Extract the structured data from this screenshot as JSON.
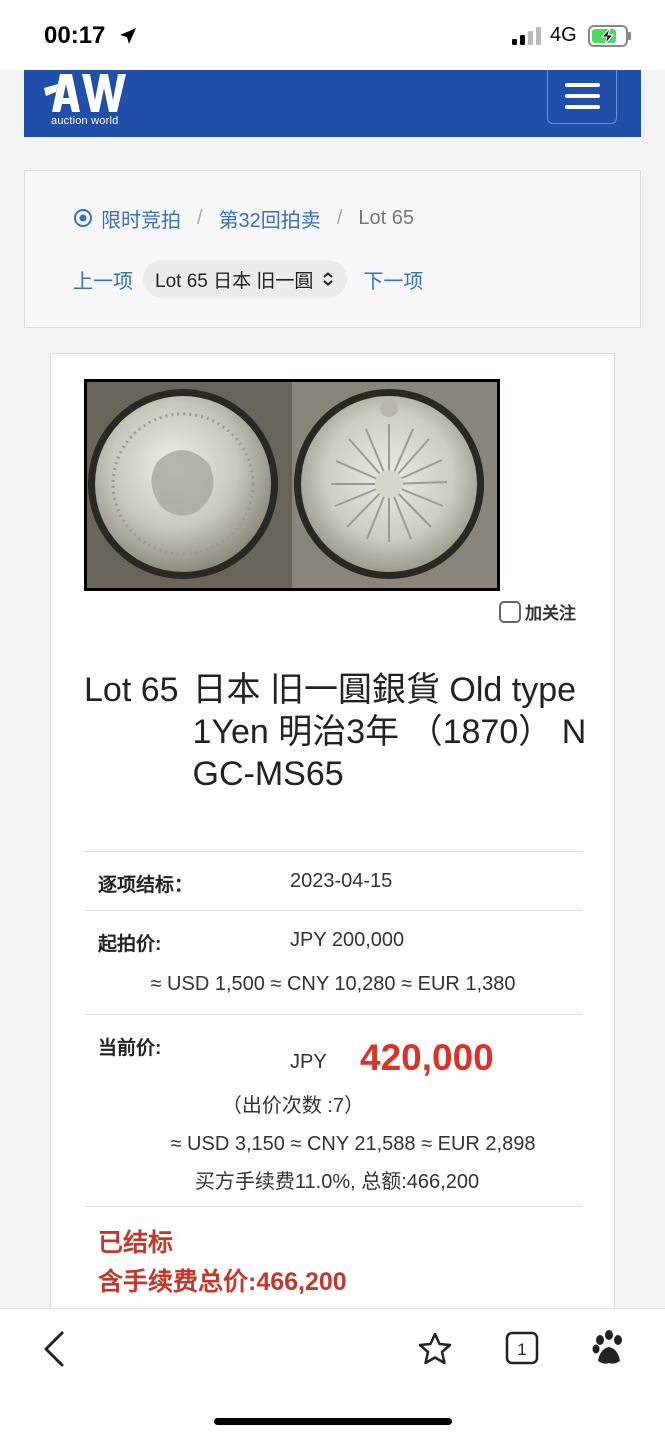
{
  "status_bar": {
    "time": "00:17",
    "network": "4G"
  },
  "navbar": {
    "logo_sub": "auction world",
    "accent_color": "#1f4fa8"
  },
  "breadcrumb": {
    "items": [
      "限时竞拍",
      "第32回拍卖",
      "Lot 65"
    ],
    "separator": "/"
  },
  "lot_nav": {
    "prev": "上一项",
    "select_value": "Lot 65 日本 旧一圓",
    "next": "下一项"
  },
  "follow": {
    "label": "加关注"
  },
  "lot": {
    "number": "Lot 65",
    "name": "日本 旧一圓銀貨 Old type 1Yen 明治3年 （1870） NGC-MS65"
  },
  "details": {
    "close_label": "逐项结标：",
    "close_date": "2023-04-15",
    "start_label": "起拍价:",
    "start_price": "JPY 200,000",
    "start_conversions": "≈ USD 1,500 ≈ CNY 10,280 ≈ EUR 1,380",
    "current_label": "当前价:",
    "current_currency": "JPY",
    "current_price": "420,000",
    "bid_count": "（出价次数 :7）",
    "current_conversions": "≈ USD 3,150 ≈ CNY 21,588 ≈ EUR 2,898",
    "fee_note": "买方手续费11.0%, 总额:466,200",
    "status": "已结标",
    "total_with_fee": "含手续费总价:466,200"
  },
  "colors": {
    "link": "#3a6fc0",
    "price": "#d9342b",
    "sold": "#c0392b"
  }
}
